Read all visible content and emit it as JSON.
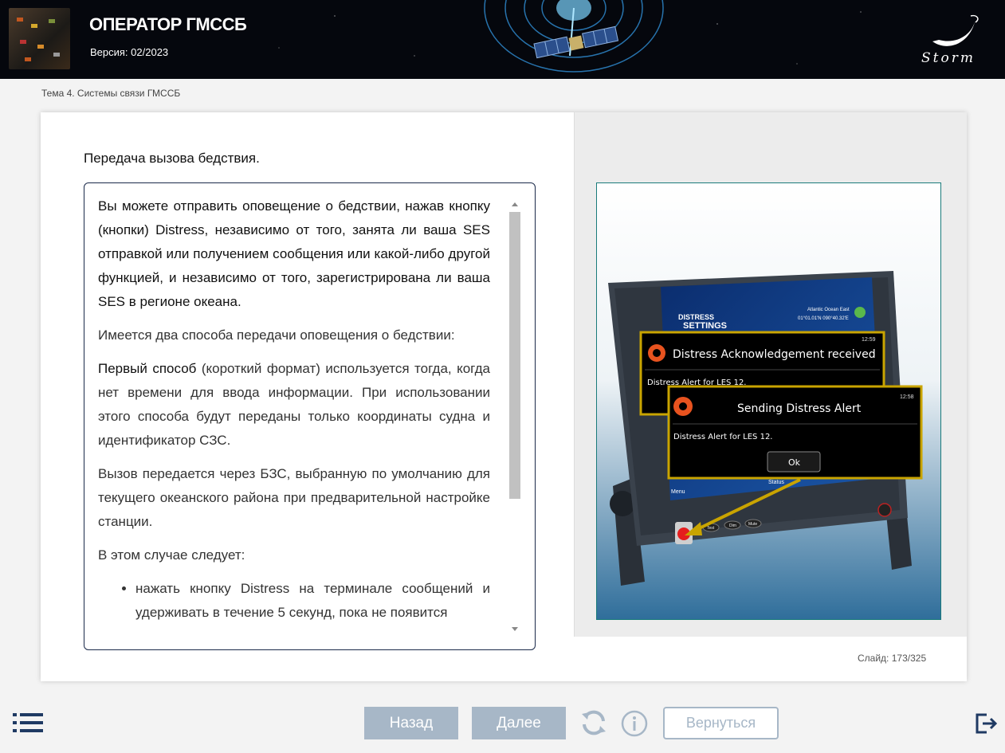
{
  "header": {
    "title": "ОПЕРАТОР ГМССБ",
    "version": "Версия: 02/2023",
    "brand": "Storm"
  },
  "breadcrumb": "Тема 4. Системы связи ГМССБ",
  "slide": {
    "title": "Передача вызова бедствия.",
    "paragraphs": {
      "p1": "Вы можете отправить оповещение о бедствии, нажав кнопку (кнопки) Distress, независимо от того, занята ли ваша SES отправкой или получением сообщения или какой-либо другой функцией, и независимо от того, зарегистрирована ли ваша SES в регионе океана.",
      "p2": "Имеется два способа передачи оповещения о бедствии:",
      "p3_bold": "Первый способ",
      "p3_rest": " (короткий формат) используется тогда, когда нет времени для ввода информации. При использовании этого способа будут переданы только координаты судна и идентификатор СЗС.",
      "p4": "Вызов передается через БЗС, выбранную по умолчанию для текущего океанского района при предварительной настройке станции.",
      "p5": "В этом случае следует:",
      "bullet1": "нажать кнопку Distress на терминале сообщений и удерживать в течение 5 секунд, пока не появится"
    }
  },
  "terminal": {
    "screen_title": "DISTRESS SETTINGS",
    "region": "Atlantic Ocean East",
    "coords": "01°01.01'N 090°40.32'E",
    "popup1": {
      "time": "12:59",
      "title": "Distress Acknowledgement received",
      "body": "Distress Alert for LES 12."
    },
    "popup2": {
      "time": "12:58",
      "title": "Sending Distress Alert",
      "body": "Distress Alert for LES 12.",
      "ok": "Ok"
    },
    "menu_label": "Menu",
    "status_label": "Status",
    "hw_buttons": [
      "Test",
      "Dim",
      "Mute"
    ]
  },
  "footer": {
    "slide_label": "Слайд:",
    "slide_current": "173",
    "slide_sep": "/",
    "slide_total": "325"
  },
  "nav": {
    "back": "Назад",
    "next": "Далее",
    "return": "Вернуться"
  },
  "colors": {
    "header_bg": "#05070d",
    "nav_button": "#a7b7c7",
    "text_border": "#1b2a4a",
    "image_border": "#1a7b7b",
    "popup_border": "#c9a400"
  },
  "icons": [
    "menu-list-icon",
    "refresh-icon",
    "info-icon",
    "exit-icon"
  ]
}
